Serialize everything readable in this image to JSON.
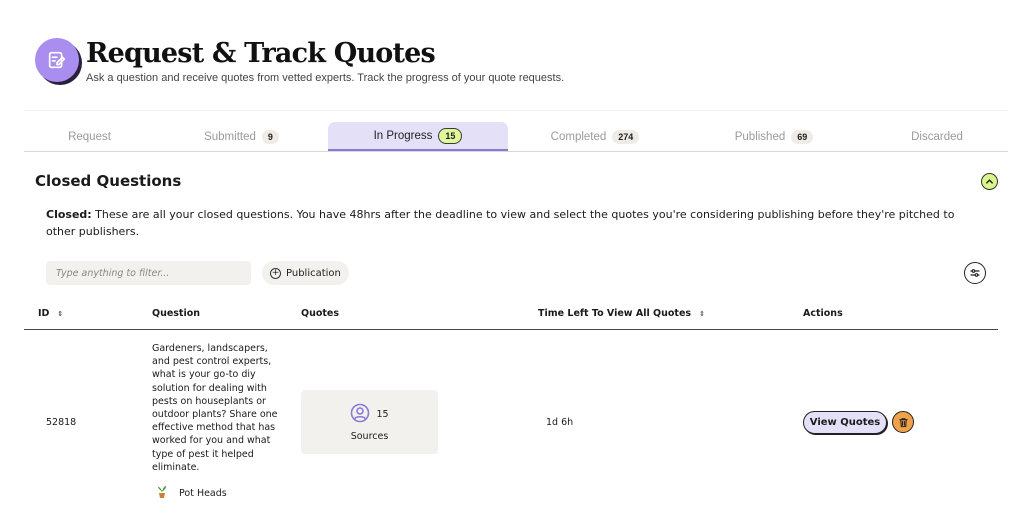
{
  "header": {
    "title": "Request & Track Quotes",
    "subtitle": "Ask a question and receive quotes from vetted experts. Track the progress of your quote requests.",
    "icon": "edit-note-icon"
  },
  "tabs": [
    {
      "label": "Request",
      "count": null,
      "active": false
    },
    {
      "label": "Submitted",
      "count": "9",
      "active": false
    },
    {
      "label": "In Progress",
      "count": "15",
      "active": true
    },
    {
      "label": "Completed",
      "count": "274",
      "active": false
    },
    {
      "label": "Published",
      "count": "69",
      "active": false
    },
    {
      "label": "Discarded",
      "count": null,
      "active": false
    }
  ],
  "section": {
    "title": "Closed Questions",
    "desc_bold": "Closed:",
    "desc_text": " These are all your closed questions. You have 48hrs after the deadline to view and select the quotes you're considering publishing before they're pitched to other publishers."
  },
  "filter": {
    "placeholder": "Type anything to filter...",
    "publication_label": "Publication"
  },
  "table": {
    "headers": {
      "id": "ID",
      "question": "Question",
      "quotes": "Quotes",
      "time_left": "Time Left To View All Quotes",
      "actions": "Actions"
    },
    "rows": [
      {
        "id": "52818",
        "question": "Gardeners, landscapers, and pest control experts, what is your go-to diy solution for dealing with pests on houseplants or outdoor plants? Share one effective method that has worked for you and what type of pest it helped eliminate.",
        "publication": "Pot Heads",
        "quotes_count": "15",
        "quotes_label": "Sources",
        "time_left": "1d 6h",
        "view_label": "View Quotes"
      }
    ]
  },
  "colors": {
    "accent_purple": "#a98ef0",
    "active_tab_bg": "#e4e0f7",
    "lime": "#e0f79a",
    "orange": "#f0a24a"
  }
}
